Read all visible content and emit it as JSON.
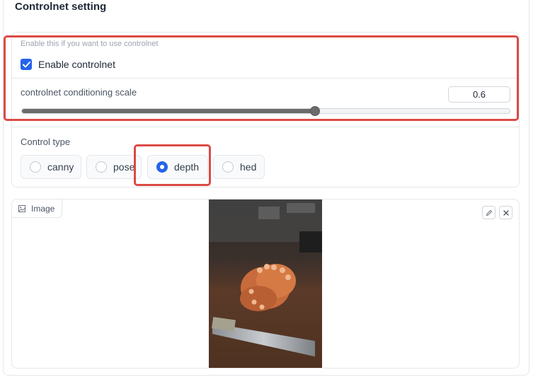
{
  "section": {
    "title": "Controlnet setting"
  },
  "enable": {
    "hint": "Enable this if you want to use controlnet",
    "label": "Enable controlnet",
    "checked": true
  },
  "scale": {
    "label": "controlnet conditioning scale",
    "value": "0.6",
    "fraction": 0.6
  },
  "control_type": {
    "label": "Control type",
    "options": [
      "canny",
      "pose",
      "depth",
      "hed"
    ],
    "selected": "depth"
  },
  "image": {
    "label": "Image",
    "edit_icon": "pencil-icon",
    "clear_icon": "close-icon"
  },
  "colors": {
    "accent": "#2563eb",
    "annotation": "#dc4a45",
    "slider_fill": "#6b6b6b"
  }
}
